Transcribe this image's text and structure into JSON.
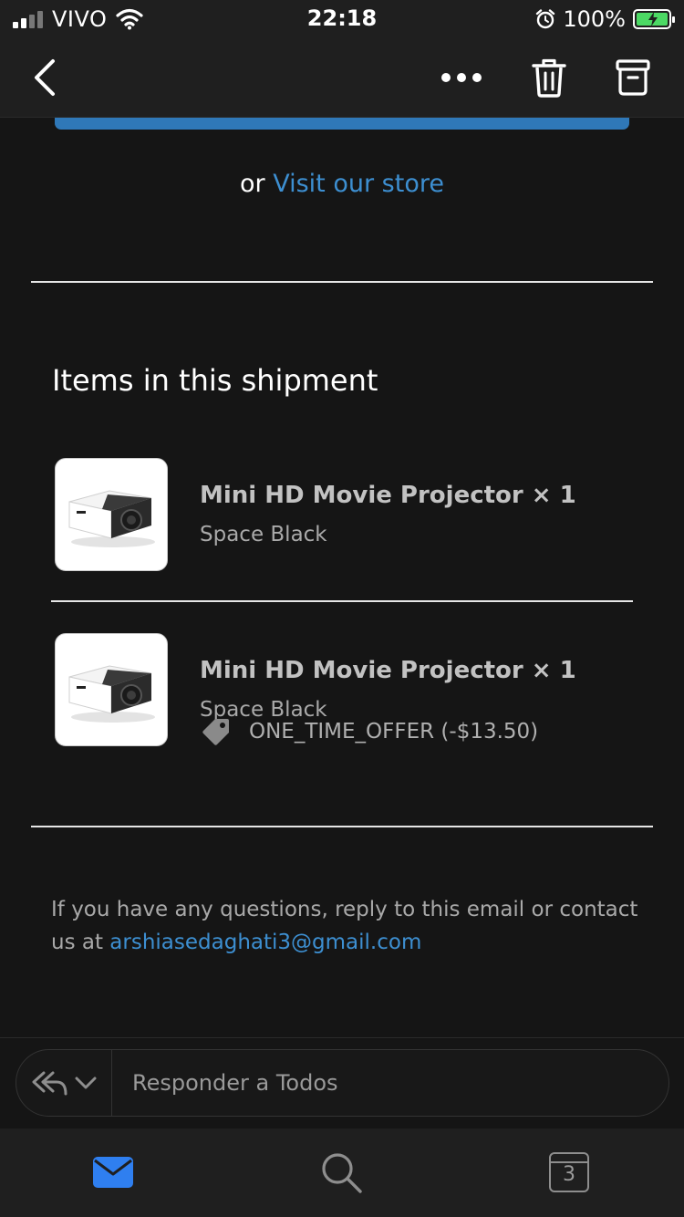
{
  "status_bar": {
    "carrier": "VIVO",
    "time": "22:18",
    "battery_percent": "100%",
    "battery_level": 1.0,
    "battery_charging": true
  },
  "nav": {
    "back_icon": "chevron-left-icon",
    "more_icon": "more-horizontal-icon",
    "trash_icon": "trash-icon",
    "archive_icon": "archive-icon"
  },
  "email": {
    "store_prefix": "or ",
    "store_link": "Visit our store",
    "section_title": "Items in this shipment",
    "items": [
      {
        "title": "Mini HD Movie Projector × 1",
        "variant": "Space Black",
        "discount": ""
      },
      {
        "title": "Mini HD Movie Projector × 1",
        "variant": "Space Black",
        "discount": "ONE_TIME_OFFER (-$13.50)"
      }
    ],
    "footer_text": "If you have any questions, reply to this email or contact us at ",
    "footer_email": "arshiasedaghati3@gmail.com"
  },
  "reply_bar": {
    "placeholder": "Responder a Todos"
  },
  "tab_bar": {
    "calendar_day": "3"
  },
  "colors": {
    "background": "#151515",
    "bar": "#1f1f1f",
    "link": "#3d8fd1",
    "cta": "#2f78b8",
    "mail_active": "#2f7ff0",
    "battery": "#4cd964"
  }
}
